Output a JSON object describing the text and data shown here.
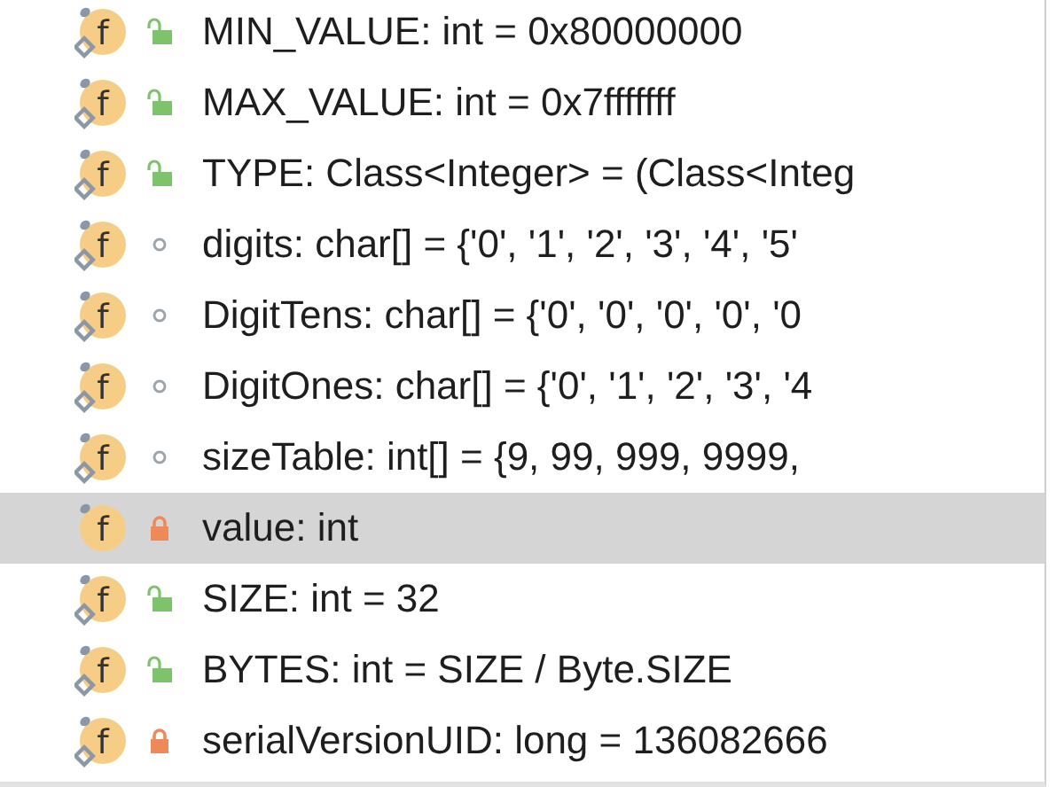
{
  "fields": [
    {
      "kind": "public",
      "icon": "f",
      "text": "MIN_VALUE: int = 0x80000000",
      "selected": false,
      "static": true
    },
    {
      "kind": "public",
      "icon": "f",
      "text": "MAX_VALUE: int = 0x7fffffff",
      "selected": false,
      "static": true
    },
    {
      "kind": "public",
      "icon": "f",
      "text": "TYPE: Class<Integer> = (Class<Integ",
      "selected": false,
      "static": true
    },
    {
      "kind": "package",
      "icon": "f",
      "text": "digits: char[] = {'0', '1', '2', '3', '4', '5'",
      "selected": false,
      "static": true
    },
    {
      "kind": "package",
      "icon": "f",
      "text": "DigitTens: char[] = {'0', '0', '0', '0', '0",
      "selected": false,
      "static": true
    },
    {
      "kind": "package",
      "icon": "f",
      "text": "DigitOnes: char[] = {'0', '1', '2', '3', '4",
      "selected": false,
      "static": true
    },
    {
      "kind": "package",
      "icon": "f",
      "text": "sizeTable: int[] = {9, 99, 999, 9999,",
      "selected": false,
      "static": true
    },
    {
      "kind": "private",
      "icon": "f",
      "text": "value: int",
      "selected": true,
      "static": false
    },
    {
      "kind": "public",
      "icon": "f",
      "text": "SIZE: int = 32",
      "selected": false,
      "static": true
    },
    {
      "kind": "public",
      "icon": "f",
      "text": "BYTES: int = SIZE / Byte.SIZE",
      "selected": false,
      "static": true
    },
    {
      "kind": "private",
      "icon": "f",
      "text": "serialVersionUID: long = 136082666",
      "selected": false,
      "static": true
    }
  ]
}
